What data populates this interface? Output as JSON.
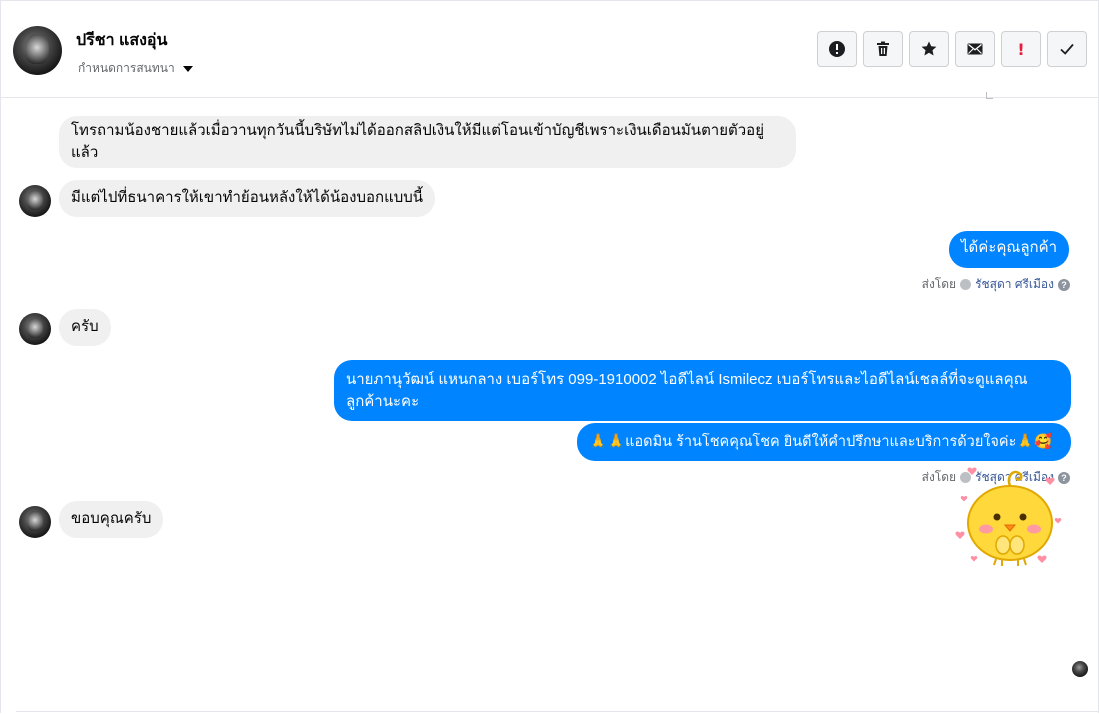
{
  "header": {
    "contact_name": "ปรีชา แสงอุ่น",
    "assign_label": "กำหนดการสนทนา",
    "actions": [
      {
        "name": "report-button",
        "icon": "alert-circle-icon"
      },
      {
        "name": "delete-button",
        "icon": "trash-icon"
      },
      {
        "name": "star-button",
        "icon": "star-icon"
      },
      {
        "name": "mark-unread-button",
        "icon": "envelope-icon"
      },
      {
        "name": "important-button",
        "icon": "exclamation-icon"
      },
      {
        "name": "mark-done-button",
        "icon": "check-icon"
      }
    ]
  },
  "messages": {
    "m1": "โทรถามน้องชายแล้วเมื่อวานทุกวันนี้บริษัทไม่ได้ออกสลิปเงินให้มีแต่โอนเข้าบัญชีเพราะเงินเดือนมันตายตัวอยู่แล้ว",
    "m2": "มีแต่ไปที่ธนาคารให้เขาทำย้อนหลังให้ได้น้องบอกแบบนี้",
    "m3": "ได้ค่ะคุณลูกค้า",
    "m4": "ครับ",
    "m5": "นายภานุวัฒน์ แหนกลาง เบอร์โทร 099-1910002 ไอดีไลน์ Ismilecz  เบอร์โทรและไอดีไลน์เชลล์ที่จะดูแลคุณลูกค้านะคะ",
    "m6": "🙏🙏แอดมิน ร้านโชคคุณโชค ยินดีให้คำปรึกษาและบริการด้วยใจค่ะ🙏🥰",
    "m7": "ขอบคุณครับ"
  },
  "sent_by": {
    "prefix": "ส่งโดย",
    "agent": "รัชสุดา ศรีเมือง",
    "help": "?"
  },
  "sticker": {
    "name": "chick-sticker",
    "colors": {
      "body": "#ffd83b",
      "outline": "#e0a800",
      "cheek": "#ff9aa2",
      "heart": "#ff8fa3"
    }
  },
  "colors": {
    "outgoing": "#0084ff",
    "incoming": "#f0f0f0",
    "agent_link": "#385898",
    "important": "#e41e3f"
  }
}
